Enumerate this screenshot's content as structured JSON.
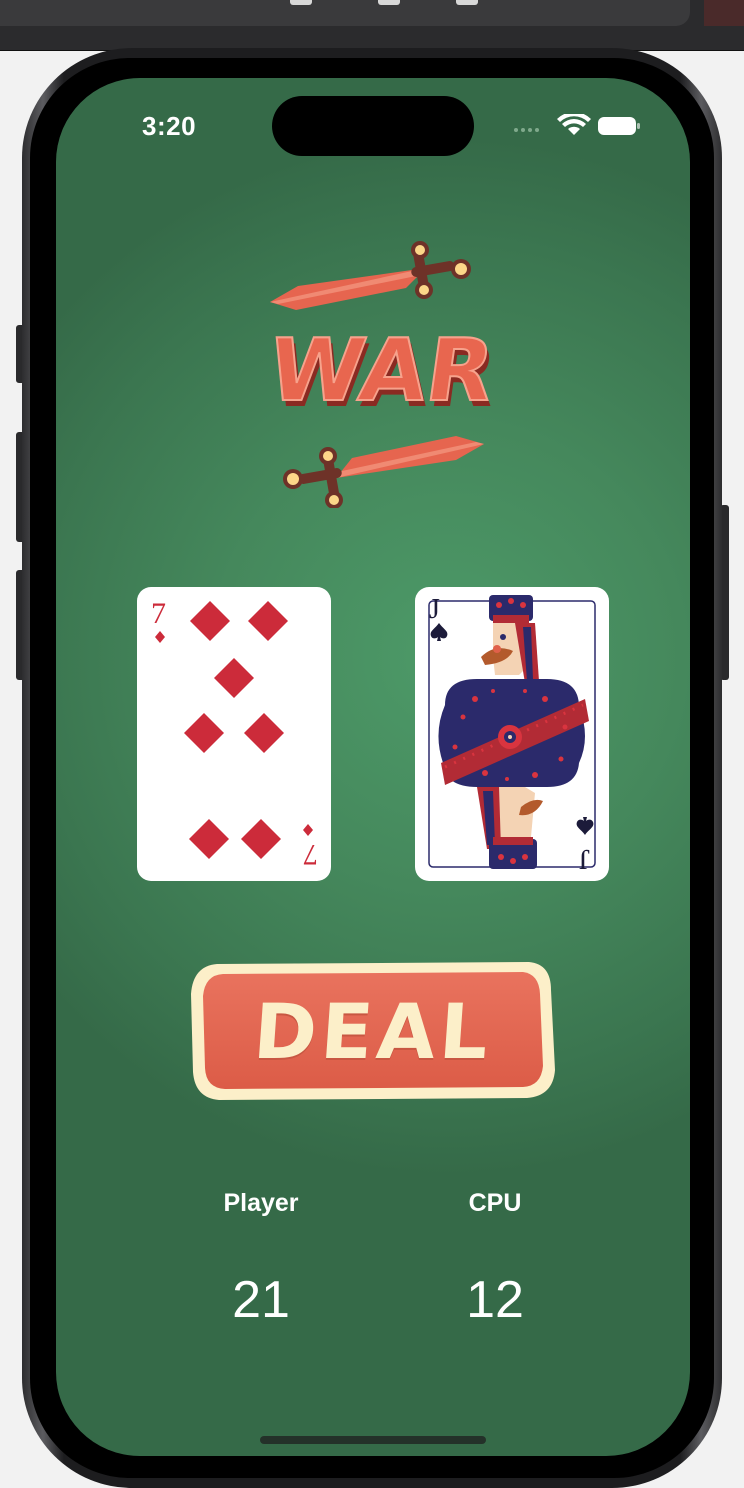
{
  "status_bar": {
    "time": "3:20"
  },
  "app": {
    "logo_text": "WAR",
    "player_card": {
      "rank": "7",
      "suit": "diamonds",
      "suit_symbol": "♦"
    },
    "cpu_card": {
      "rank": "J",
      "suit": "spades",
      "suit_symbol": "♠"
    },
    "deal_button_label": "DEAL",
    "scores": {
      "player_label": "Player",
      "player_value": "21",
      "cpu_label": "CPU",
      "cpu_value": "12"
    }
  },
  "colors": {
    "table_green": "#45885c",
    "accent_red": "#e0604a",
    "cream": "#fcefc9",
    "diamond_red": "#cc2b3a",
    "navy": "#2b2a6b"
  }
}
